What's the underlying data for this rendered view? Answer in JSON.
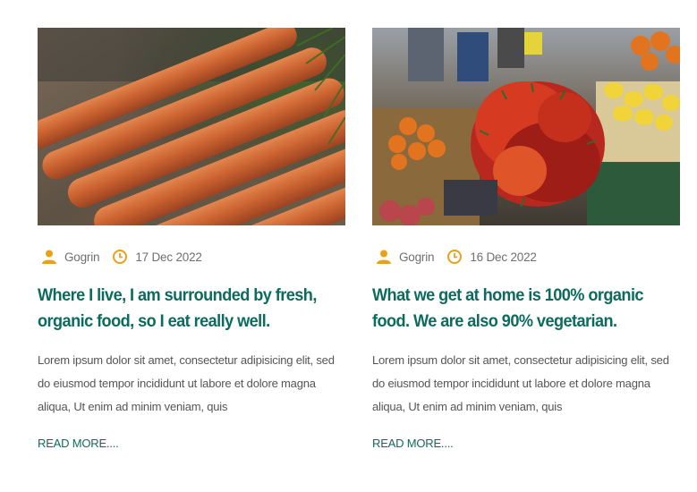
{
  "posts": [
    {
      "image_alt": "carrots",
      "author": "Gogrin",
      "date": "17 Dec 2022",
      "title": "Where I live, I am surrounded by fresh, organic food, so I eat really well.",
      "excerpt": "Lorem ipsum dolor sit amet, consectetur adipisicing elit, sed do eiusmod tempor incididunt ut labore et dolore magna aliqua, Ut enim ad minim veniam, quis",
      "read_more": "READ MORE...."
    },
    {
      "image_alt": "market stall with chili peppers",
      "author": "Gogrin",
      "date": "16 Dec 2022",
      "title": "What we get at home is 100% organic food. We are also 90% vegetarian.",
      "excerpt": "Lorem ipsum dolor sit amet, consectetur adipisicing elit, sed do eiusmod tempor incididunt ut labore et dolore magna aliqua, Ut enim ad minim veniam, quis",
      "read_more": "READ MORE...."
    }
  ],
  "colors": {
    "accent_icon": "#e8a21a",
    "title": "#0b6b5e",
    "meta_text": "#6f6f6f",
    "body_text": "#555555"
  },
  "icons": {
    "author": "user-icon",
    "date": "clock-icon"
  }
}
